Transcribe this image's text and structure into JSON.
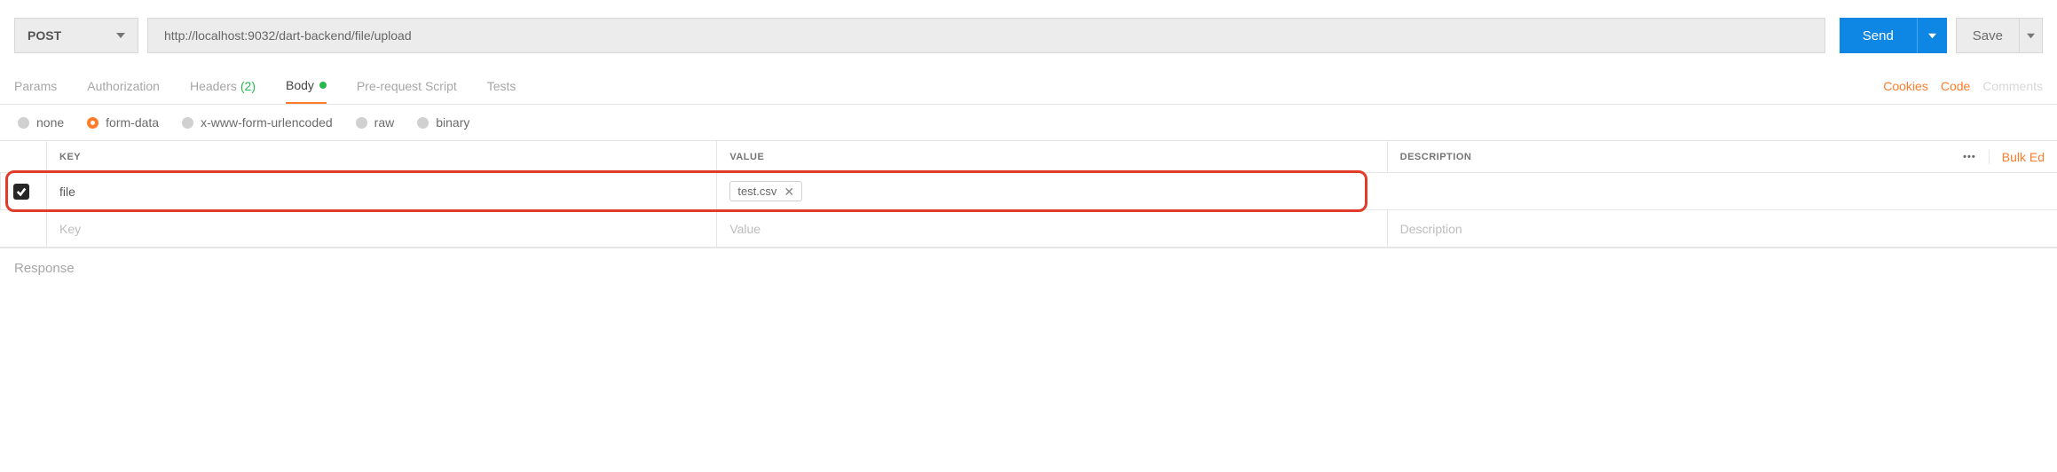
{
  "request": {
    "method": "POST",
    "url": "http://localhost:9032/dart-backend/file/upload",
    "send_label": "Send",
    "save_label": "Save"
  },
  "tabs": {
    "params": "Params",
    "authorization": "Authorization",
    "headers": "Headers",
    "headers_count": "(2)",
    "body": "Body",
    "pre_request": "Pre-request Script",
    "tests": "Tests"
  },
  "right_links": {
    "cookies": "Cookies",
    "code": "Code",
    "comments": "Comments"
  },
  "body_types": {
    "none": "none",
    "form_data": "form-data",
    "urlencoded": "x-www-form-urlencoded",
    "raw": "raw",
    "binary": "binary"
  },
  "table": {
    "headers": {
      "key": "KEY",
      "value": "VALUE",
      "description": "DESCRIPTION"
    },
    "bulk_edit": "Bulk Ed",
    "rows": [
      {
        "checked": true,
        "key": "file",
        "file_name": "test.csv",
        "description": ""
      }
    ],
    "placeholder": {
      "key": "Key",
      "value": "Value",
      "description": "Description"
    }
  },
  "response_label": "Response"
}
